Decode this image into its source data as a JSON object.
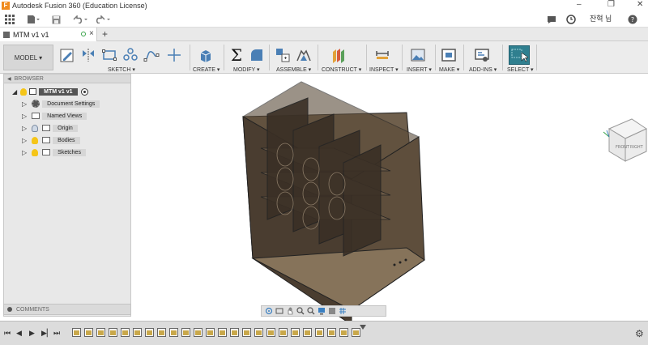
{
  "window": {
    "title": "Autodesk Fusion 360 (Education License)",
    "minimize": "–",
    "restore": "❐",
    "close": "✕"
  },
  "user": {
    "name": "잔혁 님"
  },
  "help": "?",
  "document_tab": {
    "label": "MTM v1 v1",
    "add": "+"
  },
  "workspace": {
    "label": "MODEL ▾"
  },
  "toolbar_groups": [
    {
      "label": "SKETCH ▾"
    },
    {
      "label": "CREATE ▾"
    },
    {
      "label": "MODIFY ▾"
    },
    {
      "label": "ASSEMBLE ▾"
    },
    {
      "label": "CONSTRUCT ▾"
    },
    {
      "label": "INSPECT ▾"
    },
    {
      "label": "INSERT ▾"
    },
    {
      "label": "MAKE ▾"
    },
    {
      "label": "ADD-INS ▾"
    },
    {
      "label": "SELECT ▾"
    }
  ],
  "browser": {
    "title": "BROWSER",
    "root": "MTM v1 v1",
    "items": [
      {
        "label": "Document Settings"
      },
      {
        "label": "Named Views"
      },
      {
        "label": "Origin"
      },
      {
        "label": "Bodies"
      },
      {
        "label": "Sketches"
      }
    ]
  },
  "comments": {
    "title": "COMMENTS"
  },
  "viewcube": {
    "front": "FRONT",
    "right": "RIGHT"
  },
  "colors": {
    "accent": "#3a7fc1",
    "select_active": "#2f7f8f",
    "body_fill": "#5a4a38",
    "timeline_icon": "#c9a84a"
  },
  "timeline_count": 24
}
